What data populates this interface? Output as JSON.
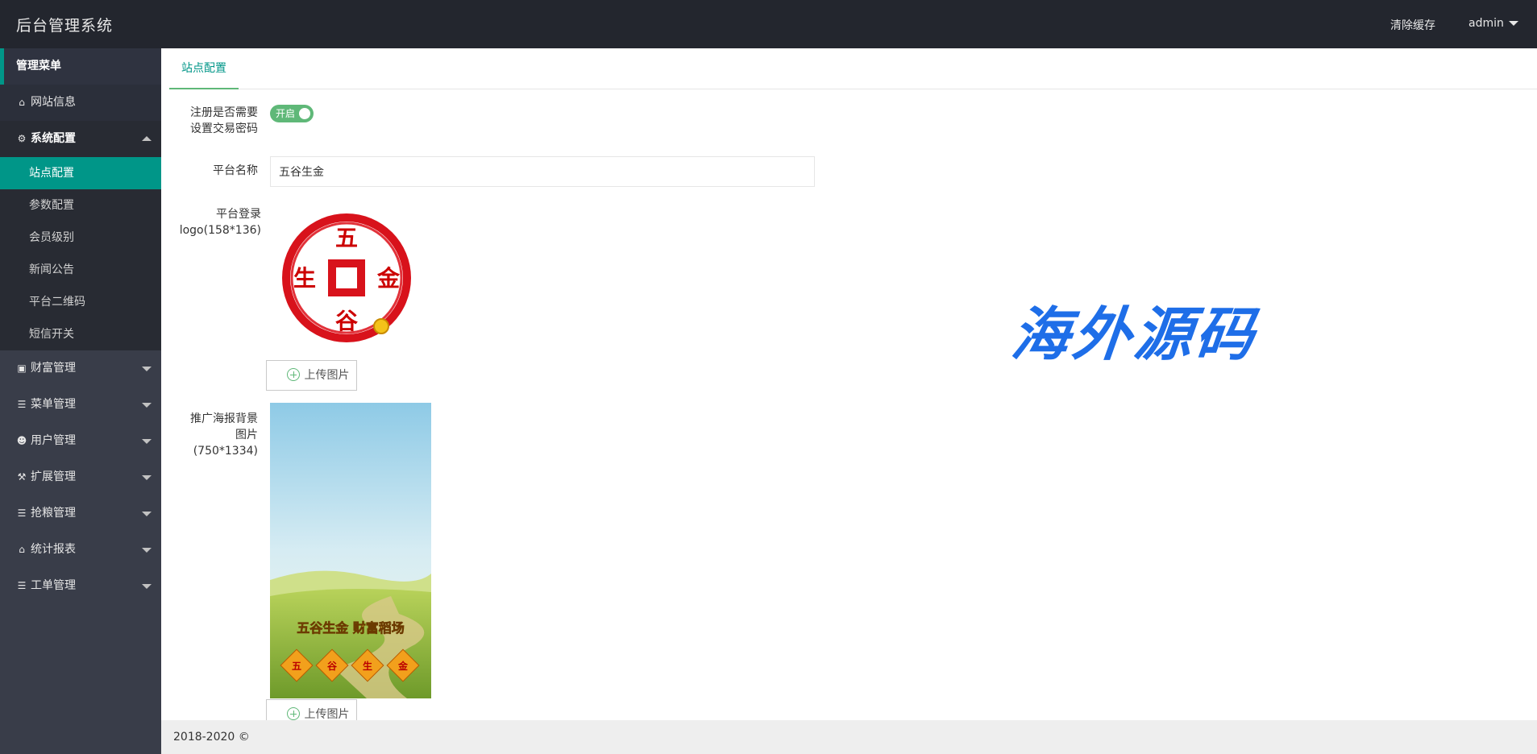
{
  "header": {
    "title": "后台管理系统",
    "clear_cache": "清除缓存",
    "user": "admin"
  },
  "sidebar": {
    "heading": "管理菜单",
    "items": [
      {
        "label": "网站信息",
        "icon": "home-icon"
      },
      {
        "label": "系统配置",
        "icon": "gears-icon",
        "expanded": true,
        "children": [
          "站点配置",
          "参数配置",
          "会员级别",
          "新闻公告",
          "平台二维码",
          "短信开关"
        ],
        "active_child": "站点配置"
      },
      {
        "label": "财富管理",
        "icon": "money-icon"
      },
      {
        "label": "菜单管理",
        "icon": "list-icon"
      },
      {
        "label": "用户管理",
        "icon": "users-icon"
      },
      {
        "label": "扩展管理",
        "icon": "wrench-icon"
      },
      {
        "label": "抢粮管理",
        "icon": "list-icon"
      },
      {
        "label": "统计报表",
        "icon": "home-icon"
      },
      {
        "label": "工单管理",
        "icon": "list-icon"
      }
    ]
  },
  "tabs": [
    "站点配置"
  ],
  "form": {
    "require_trade_pwd": {
      "label_line1": "注册是否需要",
      "label_line2": "设置交易密码",
      "toggle_text": "开启",
      "on": true
    },
    "platform_name": {
      "label": "平台名称",
      "value": "五谷生金"
    },
    "login_logo": {
      "label_line1": "平台登录",
      "label_line2": "logo(158*136)",
      "seal_chars": {
        "top": "五",
        "left": "生",
        "right": "金",
        "bottom": "谷"
      }
    },
    "upload_label": "上传图片",
    "poster": {
      "label_line1": "推广海报背景",
      "label_line2": "图片",
      "label_line3": "(750*1334)",
      "slogan": "五谷生金 财富稻场",
      "badges": [
        "五",
        "谷",
        "生",
        "金"
      ]
    }
  },
  "watermark": "海外源码",
  "footer": {
    "copyright": "2018-2020 ©"
  },
  "colors": {
    "accent": "#009688",
    "switch_on": "#5fb878",
    "header_bg": "#23262e",
    "sidebar_bg": "#393d49",
    "watermark": "#1e6ee8"
  }
}
